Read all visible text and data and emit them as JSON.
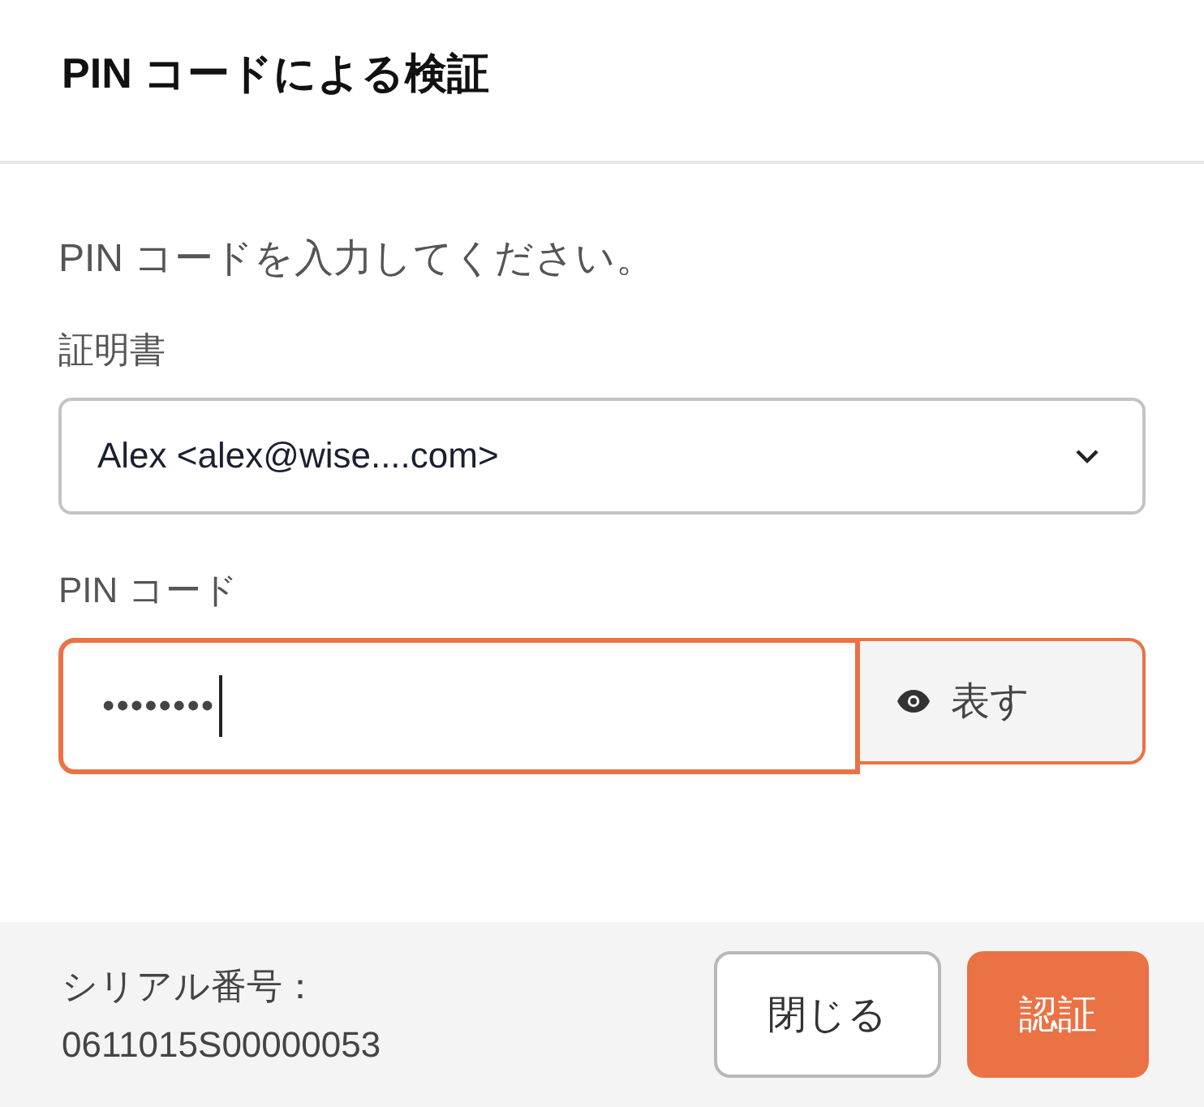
{
  "dialog": {
    "title": "PIN コードによる検証"
  },
  "instruction": "PIN コードを入力してください。",
  "certificate": {
    "label": "証明書",
    "value": "Alex <alex@wise....com>"
  },
  "pin": {
    "label": "PIN コード",
    "value": "••••••••",
    "focused": true,
    "toggle_label": "表す"
  },
  "footer": {
    "serial_label": "シリアル番号：",
    "serial_value": "0611015S00000053",
    "buttons": [
      {
        "label": "閉じる",
        "kind": "secondary"
      },
      {
        "label": "認証",
        "kind": "primary"
      }
    ]
  }
}
